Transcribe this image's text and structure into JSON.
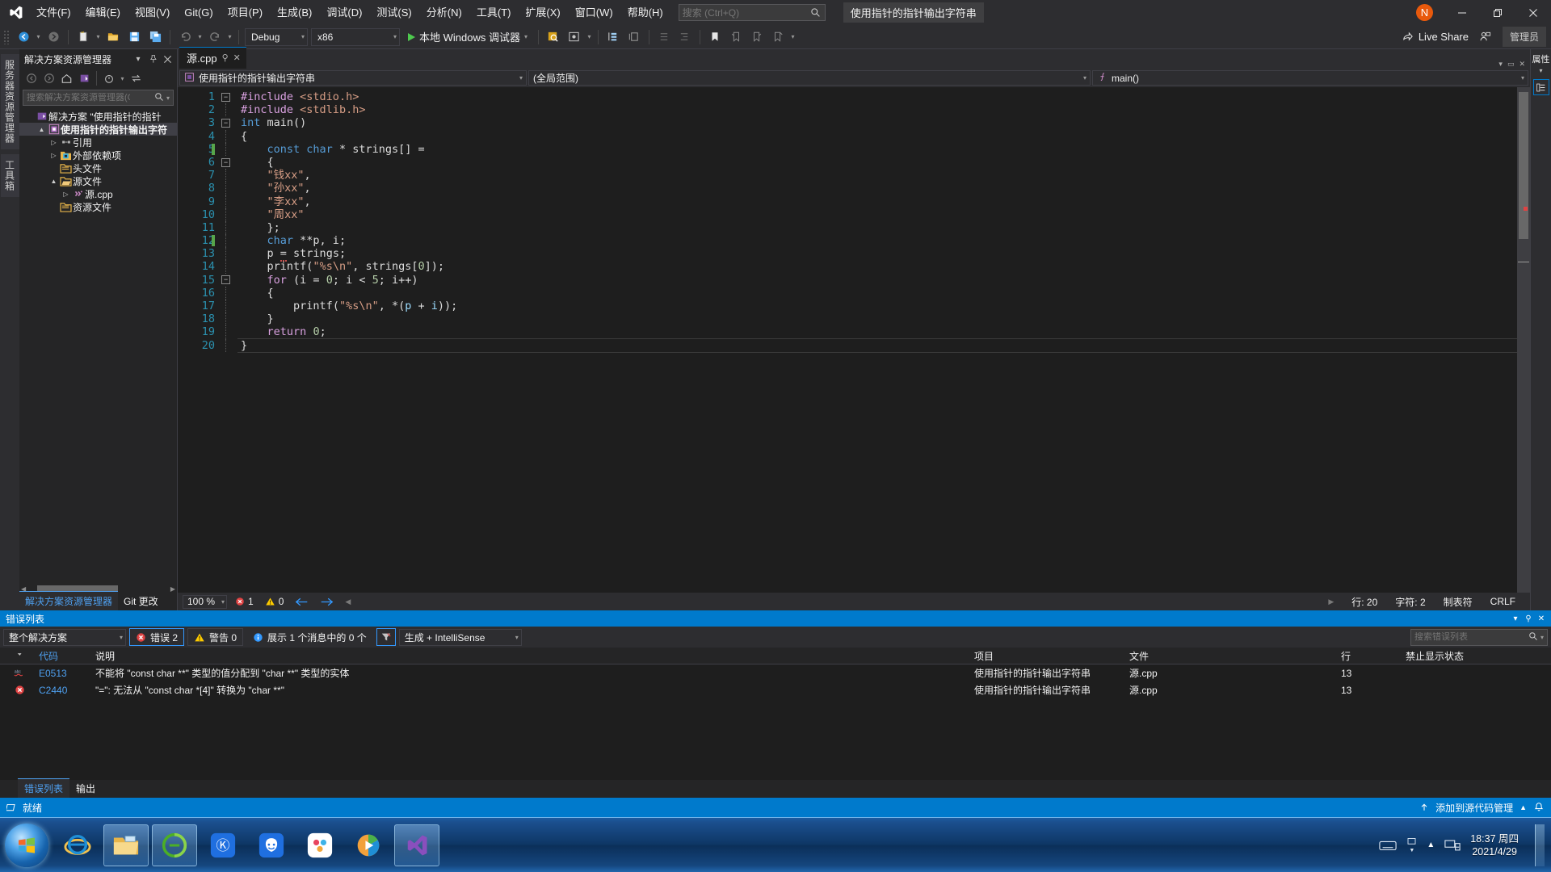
{
  "window": {
    "title": "使用指针的指针输出字符串",
    "avatar_letter": "N",
    "admin_badge": "管理员",
    "live_share": "Live Share"
  },
  "menu": {
    "items": [
      "文件(F)",
      "编辑(E)",
      "视图(V)",
      "Git(G)",
      "项目(P)",
      "生成(B)",
      "调试(D)",
      "测试(S)",
      "分析(N)",
      "工具(T)",
      "扩展(X)",
      "窗口(W)",
      "帮助(H)"
    ],
    "search_placeholder": "搜索 (Ctrl+Q)"
  },
  "toolbar": {
    "config": "Debug",
    "platform": "x86",
    "run_label": "本地 Windows 调试器"
  },
  "left_vtabs": [
    "服务器资源管理器",
    "工具箱"
  ],
  "solution_explorer": {
    "title": "解决方案资源管理器",
    "search_placeholder": "搜索解决方案资源管理器(C",
    "tree": [
      {
        "label": "解决方案 \"使用指针的指针",
        "indent": 0,
        "twist": "",
        "icon": "solution-icon",
        "selected": false
      },
      {
        "label": "使用指针的指针输出字符",
        "indent": 1,
        "twist": "▲",
        "icon": "project-icon",
        "selected": true
      },
      {
        "label": "引用",
        "indent": 2,
        "twist": "▷",
        "icon": "references-icon",
        "selected": false
      },
      {
        "label": "外部依赖项",
        "indent": 2,
        "twist": "▷",
        "icon": "folder-blue-icon",
        "selected": false
      },
      {
        "label": "头文件",
        "indent": 2,
        "twist": "",
        "icon": "folder-yellow-icon",
        "selected": false
      },
      {
        "label": "源文件",
        "indent": 2,
        "twist": "▲",
        "icon": "folder-open-icon",
        "selected": false
      },
      {
        "label": "源.cpp",
        "indent": 3,
        "twist": "▷",
        "icon": "cpp-file-icon",
        "selected": false
      },
      {
        "label": "资源文件",
        "indent": 2,
        "twist": "",
        "icon": "folder-yellow-icon",
        "selected": false
      }
    ],
    "bottom_tabs": [
      {
        "label": "解决方案资源管理器",
        "active": true
      },
      {
        "label": "Git 更改",
        "active": false
      }
    ]
  },
  "editor": {
    "tab_name": "源.cpp",
    "breadcrumb_project": "使用指针的指针输出字符串",
    "scope": "(全局范围)",
    "member": "main()",
    "lines": [
      {
        "n": 1,
        "fold": "minus",
        "change": "",
        "html": "<span class=\"kw2\">#include</span> <span class=\"str\">&lt;stdio.h&gt;</span>"
      },
      {
        "n": 2,
        "fold": "",
        "change": "",
        "html": "<span class=\"kw2\">#include</span> <span class=\"str\">&lt;stdlib.h&gt;</span>"
      },
      {
        "n": 3,
        "fold": "minus",
        "change": "",
        "html": "<span class=\"kw\">int</span> <span class=\"fn\">main</span><span class=\"pun\">()</span>"
      },
      {
        "n": 4,
        "fold": "",
        "change": "",
        "html": "<span class=\"pun\">{</span>"
      },
      {
        "n": 5,
        "fold": "",
        "change": "green",
        "html": "    <span class=\"kw\">const</span> <span class=\"kw\">char</span> <span class=\"pun\">*</span> <span class=\"pun\">strings[] =</span>"
      },
      {
        "n": 6,
        "fold": "minus",
        "change": "",
        "html": "    <span class=\"pun\">{</span>"
      },
      {
        "n": 7,
        "fold": "",
        "change": "",
        "html": "    <span class=\"str\">\"钱xx\"</span><span class=\"pun\">,</span>"
      },
      {
        "n": 8,
        "fold": "",
        "change": "",
        "html": "    <span class=\"str\">\"孙xx\"</span><span class=\"pun\">,</span>"
      },
      {
        "n": 9,
        "fold": "",
        "change": "",
        "html": "    <span class=\"str\">\"李xx\"</span><span class=\"pun\">,</span>"
      },
      {
        "n": 10,
        "fold": "",
        "change": "",
        "html": "    <span class=\"str\">\"周xx\"</span>"
      },
      {
        "n": 11,
        "fold": "",
        "change": "",
        "html": "    <span class=\"pun\">};</span>"
      },
      {
        "n": 12,
        "fold": "",
        "change": "green",
        "html": "    <span class=\"kw\">char</span> <span class=\"pun\">**p, i;</span>"
      },
      {
        "n": 13,
        "fold": "",
        "change": "",
        "html": "    <span class=\"pun\">p <span class=\"squig\">=</span> strings;</span>"
      },
      {
        "n": 14,
        "fold": "",
        "change": "",
        "html": "    <span class=\"fn\">printf</span><span class=\"pun\">(</span><span class=\"str\">\"%s\\n\"</span><span class=\"pun\">, strings[</span><span class=\"num\">0</span><span class=\"pun\">]);</span>"
      },
      {
        "n": 15,
        "fold": "minus",
        "change": "",
        "html": "    <span class=\"kw2\">for</span> <span class=\"pun\">(i = </span><span class=\"num\">0</span><span class=\"pun\">; i &lt; </span><span class=\"num\">5</span><span class=\"pun\">; i++)</span>"
      },
      {
        "n": 16,
        "fold": "",
        "change": "",
        "html": "    <span class=\"pun\">{</span>"
      },
      {
        "n": 17,
        "fold": "",
        "change": "",
        "html": "        <span class=\"fn\">printf</span><span class=\"pun\">(</span><span class=\"str\">\"%s\\n\"</span><span class=\"pun\">, *(</span><span class=\"id\">p</span><span class=\"pun\"> + </span><span class=\"id\">i</span><span class=\"pun\">));</span>"
      },
      {
        "n": 18,
        "fold": "",
        "change": "",
        "html": "    <span class=\"pun\">}</span>"
      },
      {
        "n": 19,
        "fold": "",
        "change": "",
        "html": "    <span class=\"kw2\">return</span> <span class=\"num\">0</span><span class=\"pun\">;</span>"
      },
      {
        "n": 20,
        "fold": "",
        "change": "",
        "html": "<span class=\"pun\">}</span>"
      }
    ],
    "status": {
      "zoom": "100 %",
      "error_count": "1",
      "warning_count": "0",
      "line": "行: 20",
      "col": "字符: 2",
      "tabs_mode": "制表符",
      "line_ending": "CRLF"
    }
  },
  "properties_panel": {
    "title": "属性"
  },
  "error_list": {
    "title": "错误列表",
    "scope": "整个解决方案",
    "errors_label": "错误 2",
    "warnings_label": "警告 0",
    "messages_label": "展示 1 个消息中的 0 个",
    "build_filter": "生成 + IntelliSense",
    "search_placeholder": "搜索错误列表",
    "columns": [
      "代码",
      "说明",
      "项目",
      "文件",
      "行",
      "禁止显示状态"
    ],
    "rows": [
      {
        "severity": "intellisense",
        "code": "E0513",
        "description": "不能将 \"const char **\" 类型的值分配到 \"char **\" 类型的实体",
        "project": "使用指针的指针输出字符串",
        "file": "源.cpp",
        "line": "13",
        "suppression": ""
      },
      {
        "severity": "error",
        "code": "C2440",
        "description": "\"=\": 无法从 \"const char *[4]\" 转换为 \"char **\"",
        "project": "使用指针的指针输出字符串",
        "file": "源.cpp",
        "line": "13",
        "suppression": ""
      }
    ],
    "bottom_tabs": [
      {
        "label": "错误列表",
        "active": true
      },
      {
        "label": "输出",
        "active": false
      }
    ]
  },
  "status_bar": {
    "ready": "就绪",
    "source_control": "添加到源代码管理"
  },
  "taskbar": {
    "clock_time": "18:37 周四",
    "clock_date": "2021/4/29"
  },
  "colors": {
    "accent": "#007acc",
    "error_red": "#e04343",
    "warning_yellow": "#ffcc00",
    "link_blue": "#4ea0f0"
  }
}
